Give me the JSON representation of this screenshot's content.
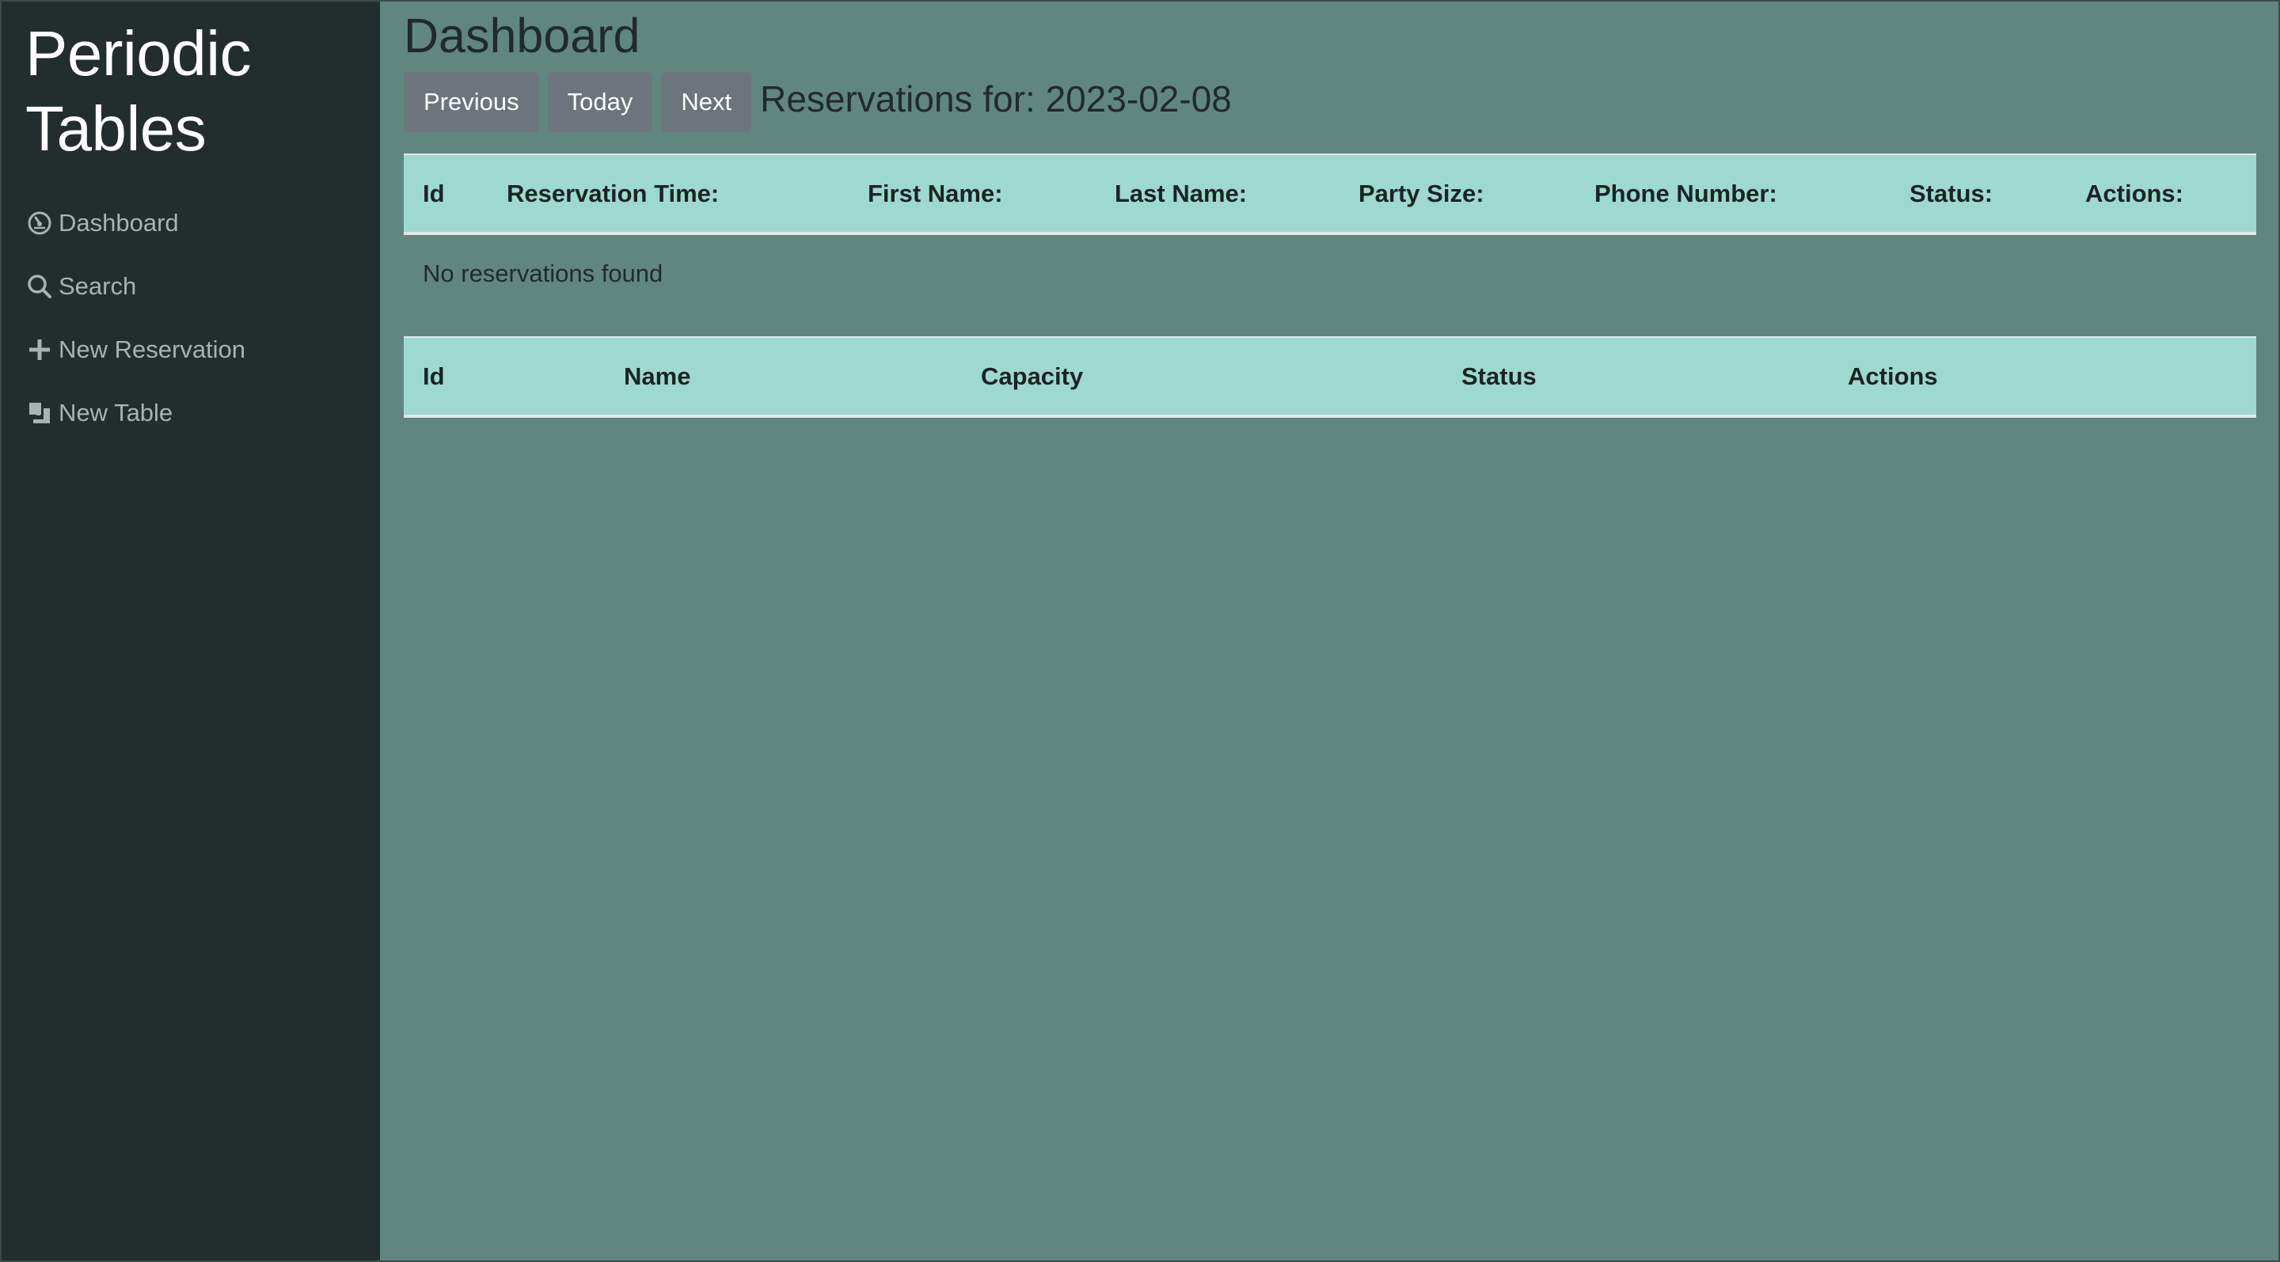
{
  "sidebar": {
    "brand": "Periodic Tables",
    "brand_line1": "Periodic",
    "brand_line2": "Tables",
    "items": [
      {
        "label": "Dashboard",
        "icon": "dashboard-icon"
      },
      {
        "label": "Search",
        "icon": "search-icon"
      },
      {
        "label": "New Reservation",
        "icon": "plus-icon"
      },
      {
        "label": "New Table",
        "icon": "layers-icon"
      }
    ]
  },
  "main": {
    "title": "Dashboard",
    "buttons": {
      "previous": "Previous",
      "today": "Today",
      "next": "Next"
    },
    "reservations_heading": "Reservations for: 2023-02-08",
    "reservations_table": {
      "columns": [
        "Id",
        "Reservation Time:",
        "First Name:",
        "Last Name:",
        "Party Size:",
        "Phone Number:",
        "Status:",
        "Actions:"
      ],
      "empty_message": "No reservations found"
    },
    "tables_table": {
      "columns": [
        "Id",
        "Name",
        "Capacity",
        "Status",
        "Actions"
      ]
    }
  },
  "colors": {
    "sidebar_bg": "#222e2d",
    "main_bg": "#61867f",
    "table_header_bg": "#9dd9cf",
    "button_bg": "#6c757d"
  }
}
